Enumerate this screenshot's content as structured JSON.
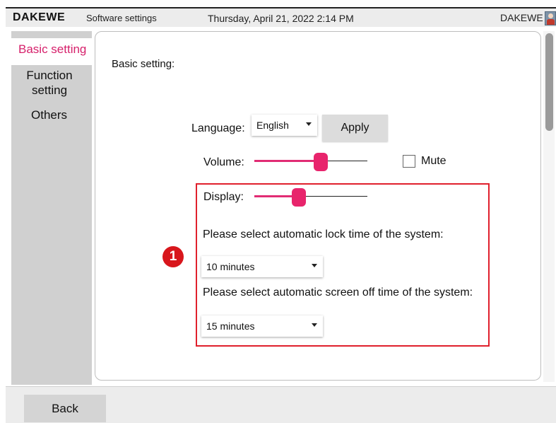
{
  "header": {
    "logo": "DAKEWE",
    "app_title": "Software settings",
    "datetime": "Thursday, April 21, 2022  2:14 PM",
    "username": "DAKEWE",
    "avatar_icon": "user-avatar-icon"
  },
  "sidebar": {
    "items": [
      {
        "label": "Basic setting",
        "active": true
      },
      {
        "label": "Function setting",
        "active": false
      },
      {
        "label": "Others",
        "active": false
      }
    ],
    "function_line1": "Function",
    "function_line2": "setting"
  },
  "main": {
    "section_title": "Basic setting:",
    "language_label": "Language:",
    "language_value": "English",
    "apply_label": "Apply",
    "volume_label": "Volume:",
    "volume_level": 0.6,
    "mute_label": "Mute",
    "mute_checked": false,
    "display_label": "Display:",
    "display_level": 0.38,
    "lock_prompt": "Please select automatic lock time of the system:",
    "lock_value": "10 minutes",
    "screen_off_prompt": "Please select automatic screen off time of the system:",
    "screen_off_value": "15 minutes",
    "callout_number": "1"
  },
  "footer": {
    "back_label": "Back"
  },
  "colors": {
    "accent": "#e8246c",
    "highlight": "#e0202c"
  }
}
